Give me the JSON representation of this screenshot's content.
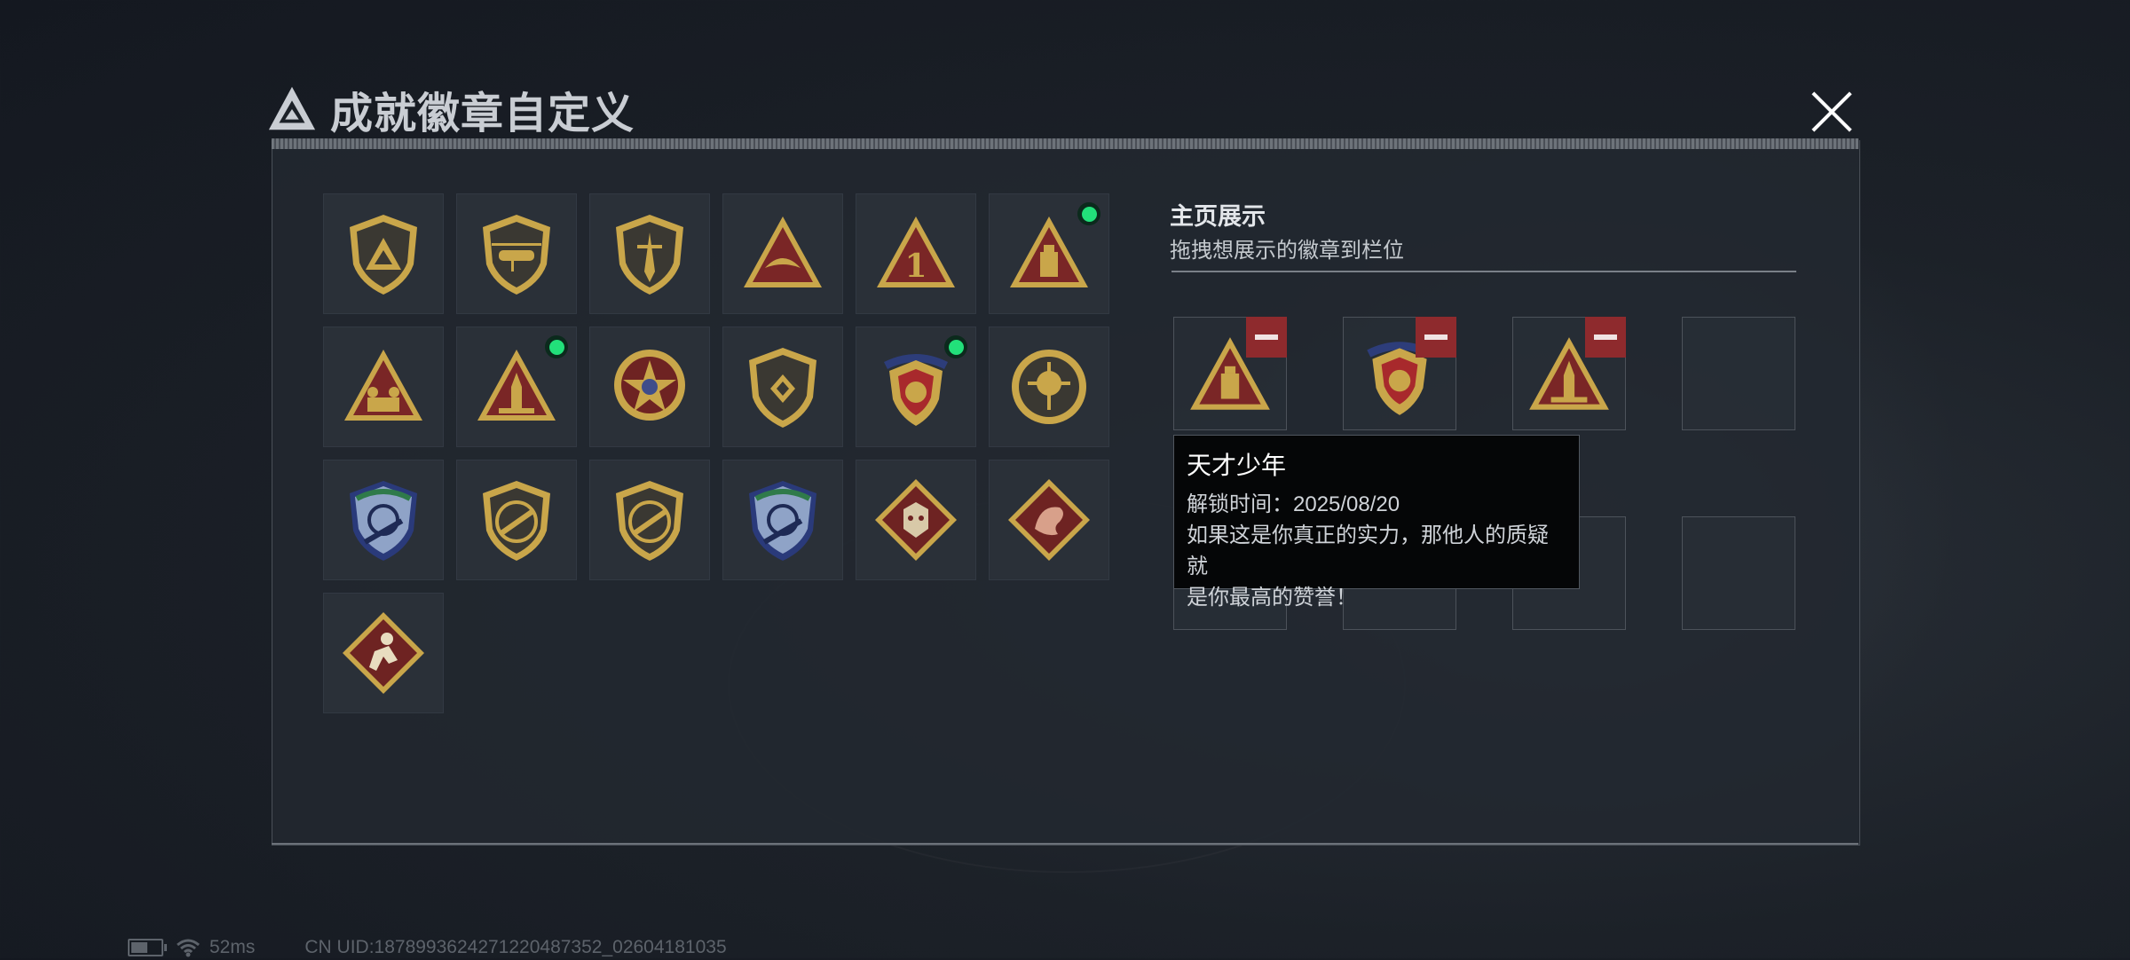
{
  "header": {
    "title": "成就徽章自定义",
    "tiny_caption": "",
    "close_label": "close"
  },
  "badges": [
    {
      "id": "b1",
      "icon": "triangle-shield-emblem-icon",
      "equipped": false
    },
    {
      "id": "b2",
      "icon": "helicopter-shield-icon",
      "equipped": false
    },
    {
      "id": "b3",
      "icon": "dagger-shield-icon",
      "equipped": false
    },
    {
      "id": "b4",
      "icon": "eagle-triangle-icon",
      "equipped": false
    },
    {
      "id": "b5",
      "icon": "number-one-triangle-icon",
      "equipped": false
    },
    {
      "id": "b6",
      "icon": "usb-triangle-icon",
      "equipped": true
    },
    {
      "id": "b7",
      "icon": "squad-triangle-icon",
      "equipped": false
    },
    {
      "id": "b8",
      "icon": "rocket-triangle-icon",
      "equipped": true
    },
    {
      "id": "b9",
      "icon": "star-medal-icon",
      "equipped": false
    },
    {
      "id": "b10",
      "icon": "emblem-shield-icon",
      "equipped": false
    },
    {
      "id": "b11",
      "icon": "gold-crest-icon",
      "equipped": true
    },
    {
      "id": "b12",
      "icon": "crosshair-skull-icon",
      "equipped": false
    },
    {
      "id": "b13",
      "icon": "sniper-shield-blue-icon",
      "equipped": false
    },
    {
      "id": "b14",
      "icon": "rifle-shield-icon",
      "equipped": false
    },
    {
      "id": "b15",
      "icon": "rifle-shield-2-icon",
      "equipped": false
    },
    {
      "id": "b16",
      "icon": "sniper-shield-blue-2-icon",
      "equipped": false
    },
    {
      "id": "b17",
      "icon": "wolf-diamond-icon",
      "equipped": false
    },
    {
      "id": "b18",
      "icon": "dragon-diamond-icon",
      "equipped": false
    },
    {
      "id": "b19",
      "icon": "runner-diamond-icon",
      "equipped": false
    }
  ],
  "showcase": {
    "title": "主页展示",
    "subtitle": "拖拽想展示的徽章到栏位",
    "slots": [
      {
        "icon": "usb-triangle-icon",
        "filled": true
      },
      {
        "icon": "gold-crest-icon",
        "filled": true
      },
      {
        "icon": "rocket-triangle-icon",
        "filled": true
      },
      {
        "icon": "",
        "filled": false
      },
      {
        "icon": "",
        "filled": false
      },
      {
        "icon": "",
        "filled": false
      },
      {
        "icon": "",
        "filled": false
      },
      {
        "icon": "",
        "filled": false
      }
    ]
  },
  "tooltip": {
    "name": "天才少年",
    "unlock": "解锁时间：2025/08/20",
    "desc1": "如果这是你真正的实力，那他人的质疑就",
    "desc2": "是你最高的赞誉！"
  },
  "status": {
    "ping": "52ms",
    "uid": "CN UID:1878993624271220487352_02604181035"
  },
  "colors": {
    "accent_green": "#22e07a",
    "remove_red": "#8e2a2d",
    "gold": "#c9a64a",
    "maroon": "#7a2626"
  }
}
